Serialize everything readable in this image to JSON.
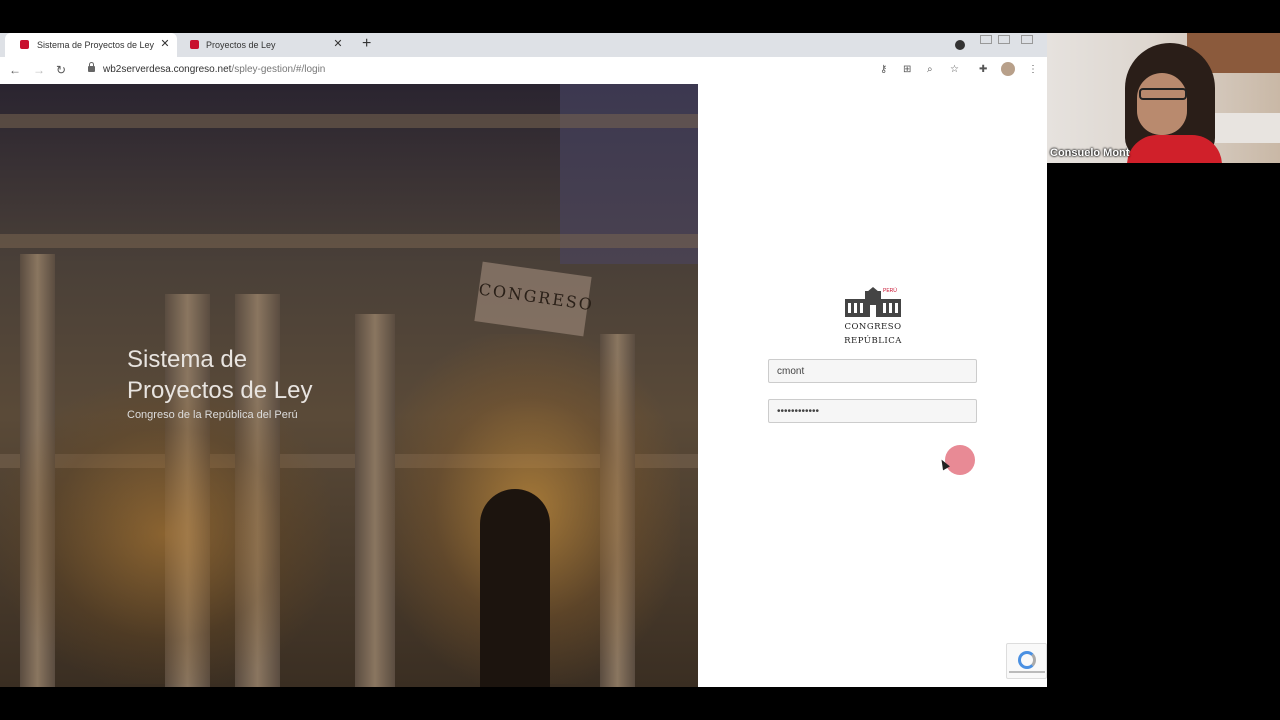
{
  "browser": {
    "tabs": [
      {
        "title": "Sistema de Proyectos de Ley",
        "active": true
      },
      {
        "title": "Proyectos de Ley",
        "active": false
      }
    ],
    "url": {
      "domain": "wb2serverdesa.congreso.net",
      "path": "/spley-gestion/#/login"
    }
  },
  "hero": {
    "title_line1": "Sistema de",
    "title_line2": "Proyectos de Ley",
    "subtitle": "Congreso de la República del Perú",
    "building_sign": "CONGRESO"
  },
  "login": {
    "logo_top": "PERÚ",
    "logo_line1": "CONGRESO",
    "logo_line2": "REPÚBLICA",
    "username": "cmont",
    "password": "••••••••••••"
  },
  "video": {
    "participant_name": "Consuelo Mont"
  },
  "colors": {
    "brand_red": "#c8102e",
    "click_indicator": "#e88a95"
  }
}
